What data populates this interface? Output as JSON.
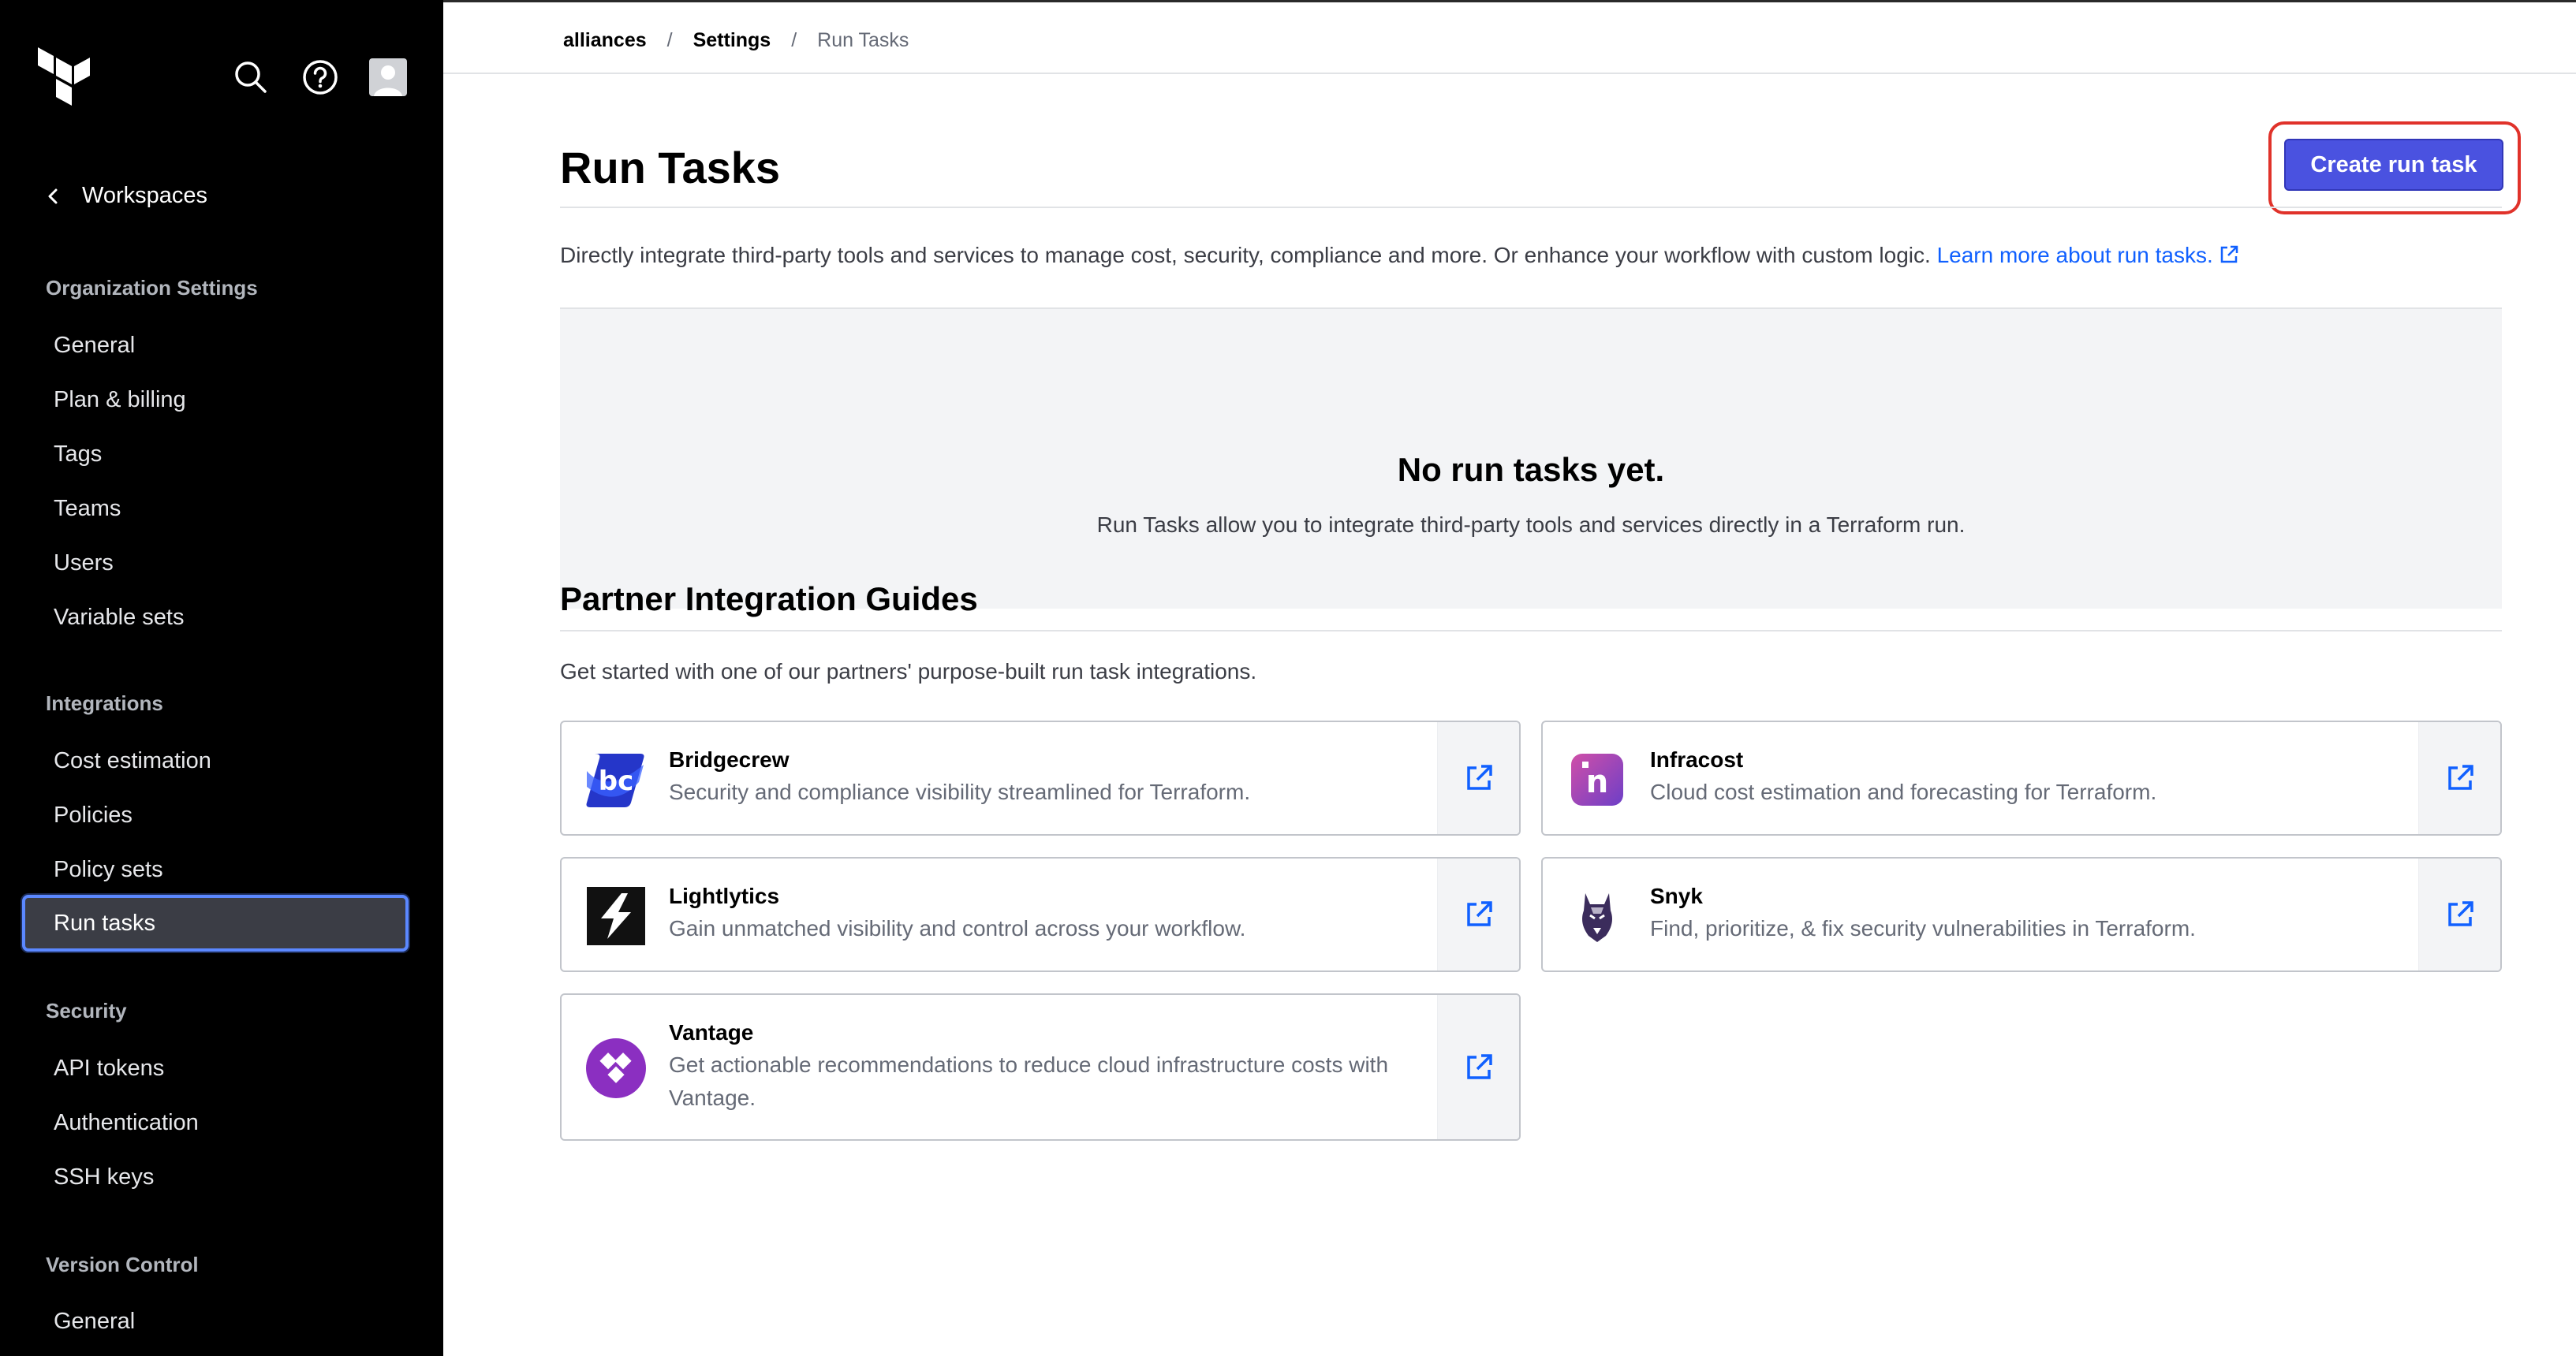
{
  "sidebar": {
    "back_label": "Workspaces",
    "sections": [
      {
        "heading": "Organization Settings",
        "items": [
          "General",
          "Plan & billing",
          "Tags",
          "Teams",
          "Users",
          "Variable sets"
        ]
      },
      {
        "heading": "Integrations",
        "items": [
          "Cost estimation",
          "Policies",
          "Policy sets",
          "Run tasks"
        ]
      },
      {
        "heading": "Security",
        "items": [
          "API tokens",
          "Authentication",
          "SSH keys"
        ]
      },
      {
        "heading": "Version Control",
        "items": [
          "General"
        ]
      }
    ],
    "active_item": "Run tasks"
  },
  "breadcrumb": {
    "org": "alliances",
    "settings": "Settings",
    "current": "Run Tasks",
    "separator": "/"
  },
  "page": {
    "title": "Run Tasks",
    "create_button": "Create run task",
    "intro_text": "Directly integrate third-party tools and services to manage cost, security, compliance and more. Or enhance your workflow with custom logic.",
    "intro_link": "Learn more about run tasks."
  },
  "empty_state": {
    "title": "No run tasks yet.",
    "description": "Run Tasks allow you to integrate third-party tools and services directly in a Terraform run."
  },
  "partners": {
    "title": "Partner Integration Guides",
    "description": "Get started with one of our partners' purpose-built run task integrations.",
    "cards": [
      {
        "name": "Bridgecrew",
        "description": "Security and compliance visibility streamlined for Terraform.",
        "logo": "bridgecrew-logo"
      },
      {
        "name": "Infracost",
        "description": "Cloud cost estimation and forecasting for Terraform.",
        "logo": "infracost-logo"
      },
      {
        "name": "Lightlytics",
        "description": "Gain unmatched visibility and control across your workflow.",
        "logo": "lightlytics-logo"
      },
      {
        "name": "Snyk",
        "description": "Find, prioritize, & fix security vulnerabilities in Terraform.",
        "logo": "snyk-logo"
      },
      {
        "name": "Vantage",
        "description": "Get actionable recommendations to reduce cloud infrastructure costs with Vantage.",
        "logo": "vantage-logo"
      }
    ]
  },
  "colors": {
    "sidebar_bg": "#000000",
    "primary_button": "#4a52e0",
    "link": "#1060ff",
    "highlight_outline": "#e0322a",
    "active_nav_border": "#5b88ff"
  }
}
